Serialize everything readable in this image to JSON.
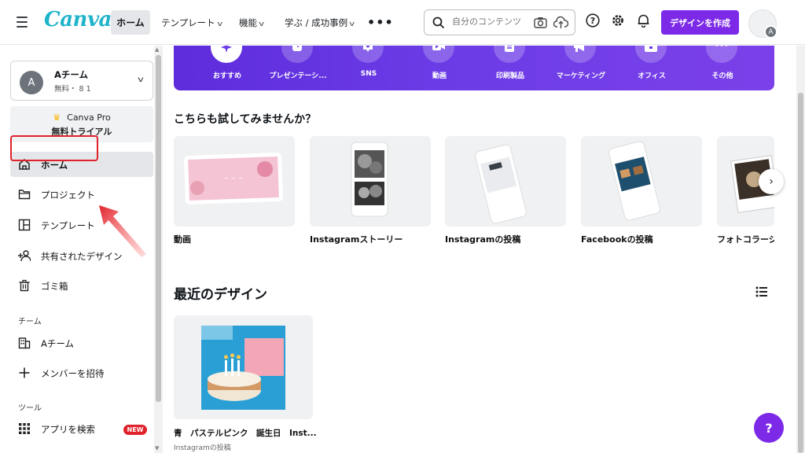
{
  "header": {
    "logo": "Canva",
    "nav": {
      "home": "ホーム",
      "templates": "テンプレート",
      "features": "機能",
      "learn": "学ぶ / 成功事例",
      "more": "•••"
    },
    "search_placeholder": "自分のコンテンツ",
    "create_button": "デザインを作成",
    "avatar_initial": "A"
  },
  "sidebar": {
    "team": {
      "initial": "A",
      "name": "Aチーム",
      "sub": "無料・ 8 1"
    },
    "pro": {
      "line1": "Canva Pro",
      "line2": "無料トライアル"
    },
    "items": [
      {
        "label": "ホーム",
        "icon": "home-icon"
      },
      {
        "label": "プロジェクト",
        "icon": "folder-icon"
      },
      {
        "label": "テンプレート",
        "icon": "template-icon"
      },
      {
        "label": "共有されたデザイン",
        "icon": "shared-people-icon"
      },
      {
        "label": "ゴミ箱",
        "icon": "trash-icon"
      }
    ],
    "team_section": {
      "title": "チーム",
      "team_item": "Aチーム",
      "invite": "メンバーを招待"
    },
    "tools_section": {
      "title": "ツール",
      "apps": "アプリを検索",
      "new_badge": "NEW"
    }
  },
  "categories": [
    {
      "label": "おすすめ",
      "icon": "sparkle-icon"
    },
    {
      "label": "プレゼンテーシ...",
      "icon": "presentation-icon"
    },
    {
      "label": "SNS",
      "icon": "heart-icon"
    },
    {
      "label": "動画",
      "icon": "video-icon"
    },
    {
      "label": "印刷製品",
      "icon": "print-icon"
    },
    {
      "label": "マーケティング",
      "icon": "megaphone-icon"
    },
    {
      "label": "オフィス",
      "icon": "briefcase-icon"
    },
    {
      "label": "その他",
      "icon": "more-icon"
    }
  ],
  "suggest": {
    "title": "こちらも試してみませんか？",
    "items": [
      {
        "label": "動画"
      },
      {
        "label": "Instagramストーリー"
      },
      {
        "label": "Instagramの投稿"
      },
      {
        "label": "Facebookの投稿"
      },
      {
        "label": "フォトコラージ"
      }
    ]
  },
  "recent": {
    "title": "最近のデザイン",
    "card_name": "青　パステルピンク　誕生日　Inst...",
    "card_type": "Instagramの投稿"
  },
  "help_label": "?",
  "colors": {
    "brand_purple": "#7d2ae8",
    "logo_teal": "#20b4cb",
    "highlight_red": "#e0222b"
  }
}
